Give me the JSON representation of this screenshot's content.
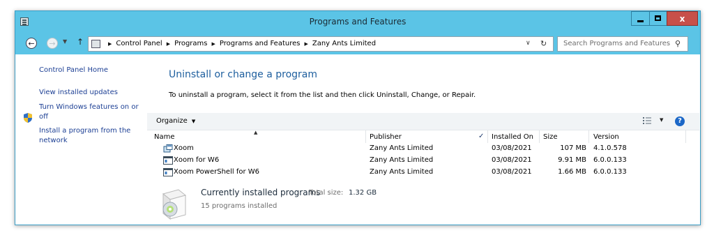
{
  "window": {
    "title": "Programs and Features",
    "close_glyph": "x"
  },
  "address": {
    "crumbs": [
      "Control Panel",
      "Programs",
      "Programs and Features",
      "Zany Ants Limited"
    ],
    "search_placeholder": "Search Programs and Features"
  },
  "left_pane": {
    "home": "Control Panel Home",
    "view_updates": "View installed updates",
    "features_line1": "Turn Windows features on or",
    "features_line2": "off",
    "install_line1": "Install a program from the",
    "install_line2": "network"
  },
  "main": {
    "title": "Uninstall or change a program",
    "description": "To uninstall a program, select it from the list and then click Uninstall, Change, or Repair."
  },
  "toolbar": {
    "organize": "Organize"
  },
  "table": {
    "columns": {
      "name": "Name",
      "publisher": "Publisher",
      "installed_on": "Installed On",
      "size": "Size",
      "version": "Version"
    },
    "rows": [
      {
        "name": "Xoom",
        "publisher": "Zany Ants Limited",
        "installed_on": "03/08/2021",
        "size": "107 MB",
        "version": "4.1.0.578",
        "icon": "xoom-app-icon"
      },
      {
        "name": "Xoom for W6",
        "publisher": "Zany Ants Limited",
        "installed_on": "03/08/2021",
        "size": "9.91 MB",
        "version": "6.0.0.133",
        "icon": "program-window-icon"
      },
      {
        "name": "Xoom PowerShell for W6",
        "publisher": "Zany Ants Limited",
        "installed_on": "03/08/2021",
        "size": "1.66 MB",
        "version": "6.0.0.133",
        "icon": "program-window-icon"
      }
    ]
  },
  "summary": {
    "title": "Currently installed programs",
    "total_label": "Total size:",
    "total_value": "1.32 GB",
    "count": "15 programs installed"
  },
  "colors": {
    "frame": "#5bc4e6",
    "close_button": "#c7504a",
    "link": "#1c3f94",
    "heading": "#1d5e9e"
  }
}
